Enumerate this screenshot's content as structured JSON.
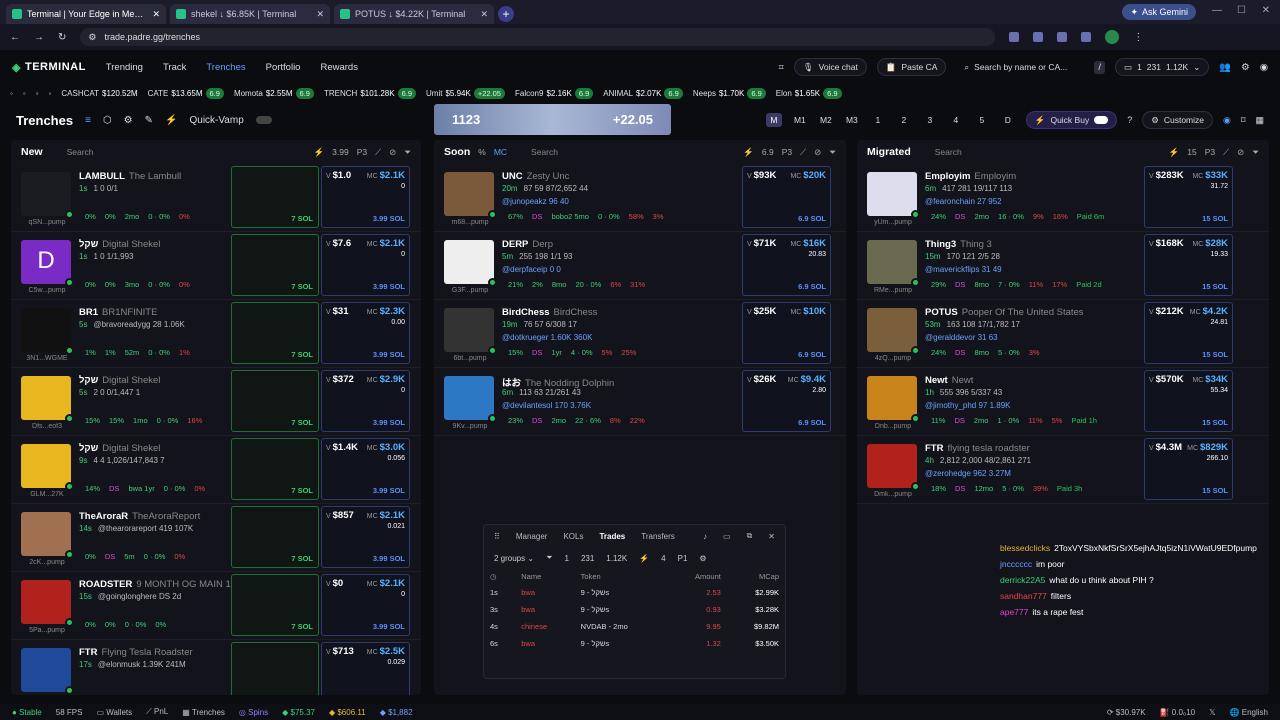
{
  "browser": {
    "tabs": [
      {
        "title": "Terminal | Your Edge in Memeco"
      },
      {
        "title": "shekel ↓ $6.85K | Terminal"
      },
      {
        "title": "POTUS ↓ $4.22K | Terminal"
      }
    ],
    "ask_gemini": "Ask Gemini",
    "url": "trade.padre.gg/trenches"
  },
  "appnav": {
    "logo": "TERMINAL",
    "links": [
      "Trending",
      "Track",
      "Trenches",
      "Portfolio",
      "Rewards"
    ],
    "voice_chat": "Voice chat",
    "paste_ca": "Paste CA",
    "search_placeholder": "Search by name or CA...",
    "slash": "/",
    "wallet_count": "1",
    "wallet_num": "231",
    "wallet_bal": "1.12K"
  },
  "ticker": [
    {
      "name": "CASHCAT",
      "val": "$120.52M"
    },
    {
      "name": "CATE",
      "val": "$13.65M",
      "b": "6.9"
    },
    {
      "name": "Momota",
      "val": "$2.55M",
      "b": "6.9"
    },
    {
      "name": "TRENCH",
      "val": "$101.28K",
      "b": "6.9"
    },
    {
      "name": "Umit",
      "val": "$5.94K",
      "b": "+22.05"
    },
    {
      "name": "Falcon9",
      "val": "$2.16K",
      "b": "6.9"
    },
    {
      "name": "ANIMAL",
      "val": "$2.07K",
      "b": "6.9"
    },
    {
      "name": "Neeps",
      "val": "$1.70K",
      "b": "6.9"
    },
    {
      "name": "Elon",
      "val": "$1.65K",
      "b": "6.9"
    }
  ],
  "toolbar": {
    "title": "Trenches",
    "quick_vamp": "Quick-Vamp",
    "banner_left": "1123",
    "banner_right": "+22.05",
    "modes": [
      "M",
      "M1",
      "M2",
      "M3",
      "1",
      "2",
      "3",
      "4",
      "5",
      "D"
    ],
    "quick_buy": "Quick Buy",
    "customize": "Customize"
  },
  "cols": {
    "new": {
      "title": "New",
      "search": "Search",
      "qv": "3.99",
      "p": "P3"
    },
    "soon": {
      "title": "Soon",
      "search": "Search",
      "pct": "%",
      "mc": "MC",
      "qv": "6.9",
      "p": "P3"
    },
    "migrated": {
      "title": "Migrated",
      "search": "Search",
      "qv": "15",
      "p": "P3"
    }
  },
  "new_tokens": [
    {
      "name": "LAMBULL",
      "sub": "The Lambull",
      "age": "1s",
      "stats": "1  0  0/1",
      "addr": "qSN...pump",
      "foot": [
        "0%",
        "0%",
        "2mo",
        "0 · 0%",
        "0%"
      ],
      "v": "$1.0",
      "mc": "$2.1K",
      "f": "0",
      "buy": "3.99 SOL",
      "bt": "7 SOL",
      "av": "#1a1c22"
    },
    {
      "name": "שקל",
      "sub": "Digital Shekel",
      "age": "1s",
      "stats": "1  0  1/1,993",
      "addr": "C5w...pump",
      "foot": [
        "0%",
        "0%",
        "3mo",
        "0 · 0%",
        "0%"
      ],
      "v": "$7.6",
      "mc": "$2.1K",
      "f": "0",
      "buy": "3.99 SOL",
      "bt": "7 SOL",
      "av": "#7a2bc4",
      "letter": "D"
    },
    {
      "name": "BR1",
      "sub": "BR1NFINITE",
      "age": "5s",
      "stats": "@bravoreadygg  28  1.06K",
      "addr": "3N1...WGME",
      "foot": [
        "1%",
        "1%",
        "52m",
        "0 · 0%",
        "1%"
      ],
      "v": "$31",
      "mc": "$2.3K",
      "f": "0.00",
      "buy": "3.99 SOL",
      "bt": "7 SOL",
      "av": "#111"
    },
    {
      "name": "שקל",
      "sub": "Digital Shekel",
      "age": "5s",
      "stats": "2  0  0/1,447  1",
      "addr": "Dfs...eof3",
      "foot": [
        "15%",
        "15%",
        "1mo",
        "0 · 0%",
        "16%"
      ],
      "v": "$372",
      "mc": "$2.9K",
      "f": "0",
      "buy": "3.99 SOL",
      "bt": "7 SOL",
      "av": "#e8b61f"
    },
    {
      "name": "שקל",
      "sub": "Digital Shekel",
      "age": "9s",
      "stats": "4  4  1,026/147,843  7",
      "addr": "GLM...27K",
      "foot": [
        "14%",
        "DS",
        "bwa 1yr",
        "0 · 0%",
        "0%"
      ],
      "v": "$1.4K",
      "mc": "$3.0K",
      "f": "0.056",
      "buy": "3.99 SOL",
      "bt": "7 SOL",
      "av": "#e8b61f"
    },
    {
      "name": "TheAroraR",
      "sub": "TheAroraReport",
      "age": "14s",
      "stats": "@thearorareport  419  107K",
      "addr": "2cK...pump",
      "foot": [
        "0%",
        "DS",
        "5m",
        "0 · 0%",
        "0%"
      ],
      "v": "$857",
      "mc": "$2.1K",
      "f": "0.021",
      "buy": "3.99 SOL",
      "bt": "7 SOL",
      "av": "#a07050"
    },
    {
      "name": "ROADSTER",
      "sub": "9 MONTH OG MAIN 1M",
      "age": "15s",
      "stats": "@goinglonghere  DS  2d",
      "addr": "5Pa...pump",
      "foot": [
        "0%",
        "0%",
        "0 · 0%",
        "0%"
      ],
      "v": "$0",
      "mc": "$2.1K",
      "f": "0",
      "buy": "3.99 SOL",
      "bt": "7 SOL",
      "av": "#b2221c"
    },
    {
      "name": "FTR",
      "sub": "Flying Tesla Roadster",
      "age": "17s",
      "stats": "@elonmusk  1.39K  241M",
      "addr": "",
      "foot": [],
      "v": "$713",
      "mc": "$2.5K",
      "f": "0.029",
      "buy": "",
      "bt": "",
      "av": "#1f4a9a"
    }
  ],
  "soon_tokens": [
    {
      "name": "UNC",
      "sub": "Zesty Unc",
      "age": "20m",
      "stats": "87  59  87/2,652  44",
      "u": "@junopeakz  96  40",
      "addr": "m68...pump",
      "foot": [
        "67%",
        "DS",
        "bobo2 5mo",
        "0 · 0%",
        "58%",
        "3%"
      ],
      "v": "$93K",
      "mc": "$20K",
      "f": "",
      "buy": "6.9 SOL",
      "av": "#7a5a3a"
    },
    {
      "name": "DERP",
      "sub": "Derp",
      "age": "5m",
      "stats": "255  198  1/1  93",
      "u": "@derpfaceip  0  0",
      "addr": "G3F...pump",
      "foot": [
        "21%",
        "2%",
        "8mo",
        "20 · 0%",
        "6%",
        "31%"
      ],
      "v": "$71K",
      "mc": "$16K",
      "f": "20.83",
      "buy": "6.9 SOL",
      "av": "#eee"
    },
    {
      "name": "BirdChess",
      "sub": "BirdChess",
      "age": "19m",
      "stats": "76  57  6/308  17",
      "u": "@dotkrueger  1.60K  360K",
      "addr": "6bt...pump",
      "foot": [
        "15%",
        "DS",
        "1yr",
        "4 · 0%",
        "5%",
        "25%"
      ],
      "v": "$25K",
      "mc": "$10K",
      "f": "",
      "buy": "6.9 SOL",
      "av": "#333"
    },
    {
      "name": "はお",
      "sub": "The Nodding Dolphin",
      "age": "6m",
      "stats": "113  63  21/261  43",
      "u": "@devilantesol  170  3.76K",
      "addr": "9Kv...pump",
      "foot": [
        "23%",
        "DS",
        "2mo",
        "22 · 6%",
        "8%",
        "22%"
      ],
      "v": "$26K",
      "mc": "$9.4K",
      "f": "2.80",
      "buy": "6.9 SOL",
      "av": "#2d78c4"
    }
  ],
  "mig_tokens": [
    {
      "name": "Employim",
      "sub": "Employim",
      "age": "6m",
      "stats": "417  281  19/117  113",
      "u": "@fearonchain  27  952",
      "addr": "yUm...pump",
      "foot": [
        "24%",
        "DS",
        "2mo",
        "16 · 0%",
        "9%",
        "16%",
        "Paid 6m"
      ],
      "v": "$283K",
      "mc": "$33K",
      "f": "31.72",
      "buy": "15 SOL",
      "av": "#dde"
    },
    {
      "name": "Thing3",
      "sub": "Thing 3",
      "age": "15m",
      "stats": "170  121  2/5  28",
      "u": "@maverickflips  31  49",
      "addr": "RMe...pump",
      "foot": [
        "29%",
        "DS",
        "8mo",
        "7 · 0%",
        "11%",
        "17%",
        "Paid 2d"
      ],
      "v": "$168K",
      "mc": "$28K",
      "f": "19.33",
      "buy": "15 SOL",
      "av": "#6a6a50"
    },
    {
      "name": "POTUS",
      "sub": "Pooper Of The United States",
      "age": "53m",
      "stats": "163  108  17/1,782  17",
      "u": "@geralddevor  31  63",
      "addr": "4zQ...pump",
      "foot": [
        "24%",
        "DS",
        "8mo",
        "5 · 0%",
        "3%"
      ],
      "v": "$212K",
      "mc": "$4.2K",
      "f": "24.81",
      "buy": "15 SOL",
      "av": "#7a5f3a"
    },
    {
      "name": "Newt",
      "sub": "Newt",
      "age": "1h",
      "stats": "555  396  5/337  43",
      "u": "@jimothy_phd  97  1.89K",
      "addr": "Dnb...pump",
      "foot": [
        "11%",
        "DS",
        "2mo",
        "1 · 0%",
        "11%",
        "5%",
        "Paid 1h"
      ],
      "v": "$570K",
      "mc": "$34K",
      "f": "55.34",
      "buy": "15 SOL",
      "av": "#c8841a"
    },
    {
      "name": "FTR",
      "sub": "flying tesla roadster",
      "age": "4h",
      "stats": "2,812  2,000  48/2,861  271",
      "u": "@zerohedge  962  3.27M",
      "addr": "Dmk...pump",
      "foot": [
        "18%",
        "DS",
        "12mo",
        "5 · 0%",
        "39%",
        "Paid 3h"
      ],
      "v": "$4.3M",
      "mc": "$829K",
      "f": "266.10",
      "buy": "15 SOL",
      "av": "#b2221c"
    }
  ],
  "manager": {
    "tabs": [
      "Manager",
      "KOLs",
      "Trades",
      "Transfers"
    ],
    "groups": "2 groups",
    "c1": "1",
    "c2": "231",
    "c3": "1.12K",
    "c4": "4",
    "p": "P1",
    "headers": [
      "Name",
      "Token",
      "Amount",
      "MCap"
    ],
    "rows": [
      {
        "t": "1s",
        "n": "bwa",
        "tok": "שקל - 9s",
        "amt": "2.53",
        "mc": "$2.99K"
      },
      {
        "t": "3s",
        "n": "bwa",
        "tok": "שקל - 9s",
        "amt": "0.93",
        "mc": "$3.28K"
      },
      {
        "t": "4s",
        "n": "chinese",
        "tok": "NVDAB - 2mo",
        "amt": "9.95",
        "mc": "$9.82M"
      },
      {
        "t": "6s",
        "n": "bwa",
        "tok": "שקל - 9s",
        "amt": "1.32",
        "mc": "$3.50K"
      }
    ]
  },
  "chat": [
    {
      "u": "blessedclicks",
      "t": "2ToxVYSbxNkfSrSrX5ejhAJtq5izN1iVWatU9EDfpump",
      "c": "#e2b53a"
    },
    {
      "u": "jncccccc",
      "t": "im poor",
      "c": "#6aa0ff"
    },
    {
      "u": "derrick22A5",
      "t": "what do u think about PIH ?",
      "c": "#3ed07a"
    },
    {
      "u": "sandhan777",
      "t": "filters",
      "c": "#e0464a"
    },
    {
      "u": "ape777",
      "t": "its a rape fest",
      "c": "#e14bd0"
    }
  ],
  "status": {
    "stable": "Stable",
    "fps": "58 FPS",
    "wallets": "Wallets",
    "pnl": "PnL",
    "trenches": "Trenches",
    "spins": "Spins",
    "sol": "$75.37",
    "eth": "$606.11",
    "bnb": "$1,882",
    "vol": "$30.97K",
    "gas": "0.0₀10",
    "lang": "English"
  }
}
